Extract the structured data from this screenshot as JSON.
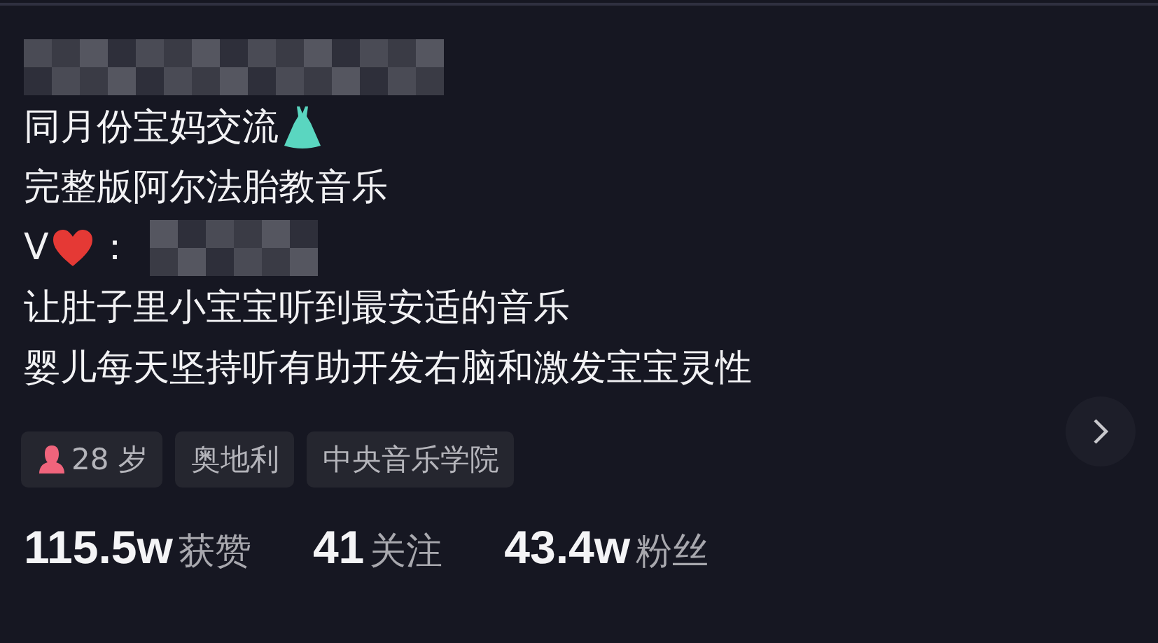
{
  "bio": [
    {
      "kind": "mosaic"
    },
    {
      "kind": "text_with_icon",
      "text": "同月份宝妈交流"
    },
    {
      "kind": "text",
      "text": "完整版阿尔法胎教音乐"
    },
    {
      "kind": "contact",
      "prefix": "V",
      "separator": "："
    },
    {
      "kind": "text",
      "text": "让肚子里小宝宝听到最安适的音乐"
    },
    {
      "kind": "text",
      "text": "婴儿每天坚持听有助开发右脑和激发宝宝灵性"
    }
  ],
  "tags": [
    {
      "kind": "age",
      "text": "28 岁"
    },
    {
      "kind": "plain",
      "text": "奥地利"
    },
    {
      "kind": "plain",
      "text": "中央音乐学院"
    }
  ],
  "stats": [
    {
      "count": "115.5w",
      "name": "获赞"
    },
    {
      "count": "41",
      "name": "关注"
    },
    {
      "count": "43.4w",
      "name": "粉丝"
    }
  ]
}
